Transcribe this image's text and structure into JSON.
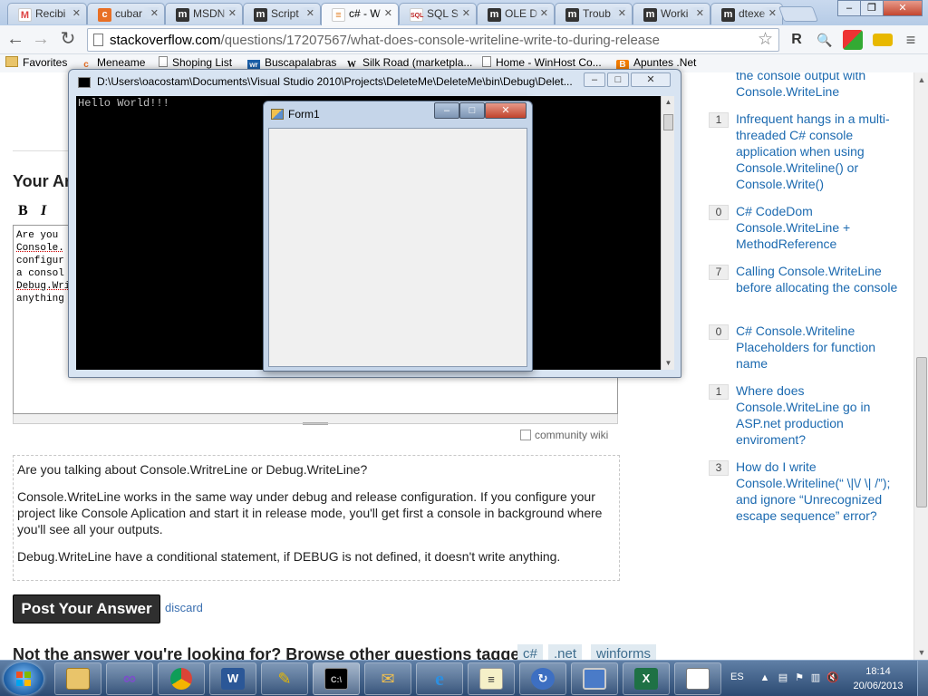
{
  "browser": {
    "tabs": [
      {
        "title": "Recibi",
        "favicon": "gmail-icon"
      },
      {
        "title": "cubar",
        "favicon": "meneame-icon"
      },
      {
        "title": "MSDN",
        "favicon": "msdn-icon"
      },
      {
        "title": "Script",
        "favicon": "msdn-icon"
      },
      {
        "title": "c# - W",
        "favicon": "stackoverflow-icon",
        "active": true
      },
      {
        "title": "SQL S",
        "favicon": "sqlcat-icon"
      },
      {
        "title": "OLE D",
        "favicon": "msdn-icon"
      },
      {
        "title": "Troub",
        "favicon": "msdn-icon"
      },
      {
        "title": "Worki",
        "favicon": "msdn-icon"
      },
      {
        "title": "dtexe",
        "favicon": "msdn-icon"
      }
    ],
    "url_host": "stackoverflow.com",
    "url_path": "/questions/17207567/what-does-console-writeline-write-to-during-release",
    "bookmarks": [
      {
        "label": "Favorites",
        "icon": "folder-icon"
      },
      {
        "label": "Meneame",
        "icon": "meneame-icon"
      },
      {
        "label": "Shoping List",
        "icon": "page-icon"
      },
      {
        "label": "Buscapalabras",
        "icon": "wr-icon"
      },
      {
        "label": "Silk Road (marketpla...",
        "icon": "w-icon"
      },
      {
        "label": "Home - WinHost Co...",
        "icon": "page-icon"
      },
      {
        "label": "Apuntes .Net",
        "icon": "blogger-icon"
      }
    ]
  },
  "page": {
    "your_answer_heading": "Your Ar",
    "editor": {
      "bold": "B",
      "italic": "I"
    },
    "textarea_lines": [
      "Are you",
      "",
      "Console.",
      "configur",
      "a consol",
      "",
      "Debug.Wri",
      "anything"
    ],
    "community_wiki": "community wiki",
    "preview": [
      "Are you talking about Console.WritreLine or Debug.WriteLine?",
      "Console.WriteLine works in the same way under debug and release configuration. If you configure your project like Console Aplication and start it in release mode, you'll get first a console in background where you'll see all your outputs.",
      "Debug.WriteLine have a conditional statement, if DEBUG is not defined, it doesn't write anything."
    ],
    "post_button": "Post Your Answer",
    "discard": "discard",
    "not_looking": "Not the answer you're looking for? Browse other questions tagged",
    "tags": [
      "c#",
      ".net",
      "winforms"
    ]
  },
  "related": [
    {
      "count": "",
      "title": "the console output with Console.WriteLine"
    },
    {
      "count": "1",
      "title": "Infrequent hangs in a multi-threaded C# console application when using Console.Writeline() or Console.Write()"
    },
    {
      "count": "0",
      "title": "C# CodeDom Console.WriteLine + MethodReference"
    },
    {
      "count": "7",
      "title": "Calling Console.WriteLine before allocating the console"
    },
    {
      "count": "0",
      "title": "C# Console.Writeline Placeholders for function name"
    },
    {
      "count": "1",
      "title": "Where does Console.WriteLine go in ASP.net production enviroment?"
    },
    {
      "count": "3",
      "title": "How do I write Console.Writeline(“ \\|\\/ \\| /”); and ignore “Unrecognized escape sequence” error?"
    }
  ],
  "console": {
    "title": "D:\\Users\\oacostam\\Documents\\Visual Studio 2010\\Projects\\DeleteMe\\DeleteMe\\bin\\Debug\\Delet...",
    "output": "Hello World!!!"
  },
  "form1": {
    "title": "Form1"
  },
  "taskbar": {
    "language": "ES",
    "time": "18:14",
    "date": "20/06/2013"
  }
}
